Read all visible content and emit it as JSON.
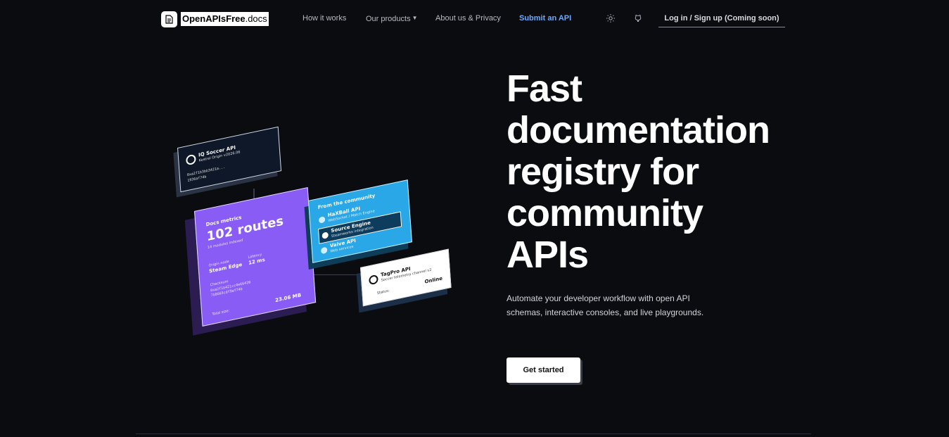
{
  "nav": {
    "logo_bold": "OpenAPIsFree",
    "logo_rest": ".docs",
    "links": [
      {
        "label": "How it works"
      },
      {
        "label": "Our products"
      },
      {
        "label": "About us & Privacy"
      },
      {
        "label": "Submit an API"
      }
    ],
    "login_label": "Log in / Sign up (Coming soon)",
    "accent_color": "#6aa9ff",
    "icons": [
      "document-icon",
      "sun-icon",
      "github-icon"
    ]
  },
  "hero": {
    "headline": [
      "Fast",
      "documentation",
      "registry for",
      "community",
      "APIs"
    ],
    "subtitle": "Automate your developer workflow with open API schemas, interactive consoles, and live playgrounds.",
    "cta_label": "Get started"
  },
  "illustration": {
    "soccer": {
      "title": "IQ Soccer API",
      "subtitle": "Kestrel Origin v2026.06",
      "hash1": "0xa2f1b3bb3421a...",
      "hash2": "1936af74b"
    },
    "metrics": {
      "title": "Docs metrics",
      "routes": "102 routes",
      "modules": "14 modules indexed",
      "origin_label": "Origin node",
      "origin_value": "Steam Edge",
      "latency_label": "Latency",
      "latency_value": "12 ms",
      "checksum_label": "Checksum",
      "checksum1": "0xa2f1b421cc4e66420",
      "checksum2": "7b8665cdf9af74b",
      "size_label": "Total size:",
      "size_value": "23.06 MB"
    },
    "community": {
      "title": "From the community",
      "items": [
        {
          "name": "HaXBall API",
          "desc": "WebSocket / Match Engine"
        },
        {
          "name": "Source Engine",
          "desc": "Steamworks integration"
        },
        {
          "name": "Valve API",
          "desc": "Web services"
        }
      ]
    },
    "tagpro": {
      "title": "TagPro API",
      "subtitle": "Soccer telemetry channel v2",
      "status_label": "Status:",
      "status_value": "Online"
    }
  }
}
